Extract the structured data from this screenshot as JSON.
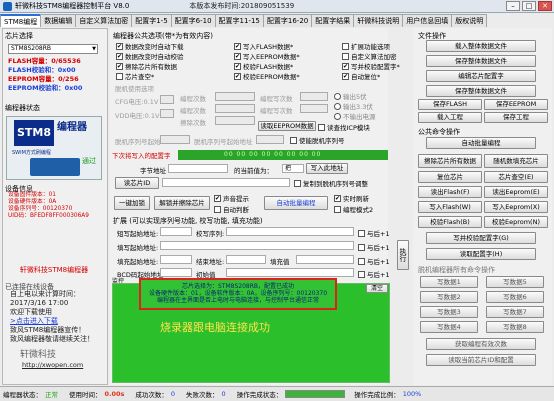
{
  "window": {
    "title": "轩微科技STM8编程器控制平台 V8.0",
    "version_note": "本版本发布时间:201809051539",
    "buttons": {
      "min": "–",
      "max": "□",
      "close": "✕"
    }
  },
  "tabs": [
    "STM8编程",
    "数据编辑",
    "自定义算法加密",
    "配置字1-5",
    "配置字6-10",
    "配置字11-15",
    "配置字16-20",
    "配置字结果",
    "轩微科技说明",
    "用户信息回填",
    "版权说明"
  ],
  "left": {
    "chip_group_title": "芯片选择",
    "chip_selected": "STM8S208RB",
    "flash_capacity": "FLASH容量：0/65536",
    "flash_checksum": "FLASH校验和：0x00",
    "eeprom_capacity": "EEPROM容量：0/256",
    "eeprom_checksum": "EEPROM校验和：0x00",
    "programmer_status_title": "编程器状态",
    "programmer_image": {
      "chip_label": "STM8",
      "product": "编程器",
      "mode": "SWIM方式刷编程",
      "pass": "通过"
    },
    "device_info_title": "设备信息",
    "device_info": [
      "设备固件版本：01",
      "设备硬件版本：0A",
      "设备序列号：00120370",
      "UID码：BFEDF8FF000306A9"
    ],
    "shop": "轩微科技STM8编程器",
    "online_label": "已连接在线设备",
    "time_line1": "自上电以来计算时间：",
    "time_line2": "2017/3/16  17:00",
    "time_line3": "欢迎下载使用",
    "time_link": ">点击进入下载",
    "time_line4": "致风STM8编程器宣传！",
    "time_line5": "致风编程器敬请继续关注！",
    "brand": "轩微科技",
    "brand_url": "http://xwopen.com"
  },
  "middle": {
    "options_title": "编程器公共选项(带*为有效内容)",
    "options_left": [
      {
        "label": "数据改变时自动下载",
        "checked": true
      },
      {
        "label": "数据改变时自动校验",
        "checked": true
      },
      {
        "label": "擦除芯片所有数据",
        "checked": true
      },
      {
        "label": "芯片查空*",
        "checked": false
      }
    ],
    "options_mid": [
      {
        "label": "写入FLASH数据*",
        "checked": true
      },
      {
        "label": "写入EEPROM数据*",
        "checked": true
      },
      {
        "label": "校验FLASH数据*",
        "checked": true
      },
      {
        "label": "校验EEPROM数据*",
        "checked": true
      }
    ],
    "options_right": [
      {
        "label": "扩展功能选项",
        "checked": false
      },
      {
        "label": "自定义算法加密",
        "checked": false
      },
      {
        "label": "写并校验配置字*",
        "checked": true
      },
      {
        "label": "自动复位*",
        "checked": true
      }
    ],
    "voltage_title": "脱机使用选项",
    "cfg_labels": [
      "CFG电压:0.1V",
      "VDD电压:0.1V"
    ],
    "write_counts": [
      "编程次数",
      "编程次数",
      "擦除次数"
    ],
    "count_fields": [
      "编程写次数",
      "编程写次数",
      "编程写次数"
    ],
    "radio_options": [
      "输出5伏",
      "输出3.3伏",
      "不输出电源"
    ],
    "read_btn": "读取EEPROM数据",
    "check_eeprom": "读查找ICP模块",
    "serial_label": "脱机序列号起始",
    "serial_label2": "脱机序列号起始地址",
    "serial_enable": "使能脱机序列号",
    "red_label": "下次将写入的配置字",
    "green_bar": "00 00 00 00 00 00 00 00",
    "byte_addr_label": "字节地址",
    "current_value_label": "的当前值为：",
    "value_field": "把",
    "write_current_btn": "写入此地址",
    "read_chip_id_btn": "读芯片ID",
    "serial_write_checkbox": "复制到脱机序列号调整",
    "one_key_encrypt_btn": "一键加锁",
    "unlock_btn": "解锁并擦除芯片",
    "sound": "声音提示",
    "auto_check": "自动判断",
    "auto_program_btn": "自动批量编程",
    "realtime": "实时刷新",
    "prog_mode": "编程模式2",
    "extend_title": "扩展 (可以实现序列号功能, 校写功能, 填充功能)",
    "extend_rows": [
      {
        "a": "短写起始地址:",
        "b": "校写序列:",
        "c": "",
        "mark": "与后+1"
      },
      {
        "a": "填写起始地址:",
        "b": "",
        "c": "",
        "mark": "与后+1"
      },
      {
        "a": "填充起始地址:",
        "b": "结束地址:",
        "c": "填充值",
        "mark": "与后+1"
      },
      {
        "a": "BCD码起始地址:",
        "b": "初始值",
        "c": "",
        "mark": "与后+1"
      }
    ],
    "exec_btn": "执行",
    "monitor_title": "监控",
    "clear_btn": "清空",
    "popup_lines": [
      "芯片选择为：STM8S208RB，配置已成功",
      "设备硬件版本：01，设备软件版本：0A，设备序列号：00120370",
      "编程器在主界面是否上电时与电脑连接，与控制平台通信正常"
    ],
    "big_msg": "烧录器跟电脑连接成功"
  },
  "right": {
    "file_title": "文件操作",
    "file_buttons": [
      "载入整体数据文件",
      "保存整体数据文件",
      "编辑芯片配置字",
      "保存整体数据文件"
    ],
    "save_buttons": [
      "保存FLASH",
      "保存EEPROM"
    ],
    "load_buttons": [
      "载入工程",
      "保存工程"
    ],
    "common_title": "公共命令操作",
    "common_buttons": [
      "自动批量编程"
    ],
    "pairs": [
      [
        "擦除芯片所有数据",
        "随机数填充芯片"
      ],
      [
        "复位芯片",
        "芯片查空(E)"
      ],
      [
        "读出Flash(F)",
        "读出Eeprom(E)"
      ],
      [
        "写入Flash(W)",
        "写入Eeprom(X)"
      ],
      [
        "校验Flash(B)",
        "校验Eeprom(N)"
      ]
    ],
    "write_verify_btn": "写并校验配置字(G)",
    "read_config_btn": "读取配置字(H)",
    "offline_title": "脱机编程器所有命令操作",
    "offline_pairs": [
      [
        "写数据1",
        "写数据5"
      ],
      [
        "写数据2",
        "写数据6"
      ],
      [
        "写数据3",
        "写数据7"
      ],
      [
        "写数据4",
        "写数据8"
      ]
    ],
    "offline_bottom": [
      "获取编程有效次数",
      "读取当前芯片ID和配置"
    ]
  },
  "status": {
    "label1": "编程器状态：",
    "value1": "正常",
    "label2": "使用时间：",
    "value2": "0.00s",
    "label3": "成功次数：",
    "value3": "0",
    "label4": "失败次数：",
    "value4": "0",
    "label5": "操作完成状态：",
    "label6": "操作完成比例：",
    "value6": "100%",
    "progress": 1.0
  }
}
